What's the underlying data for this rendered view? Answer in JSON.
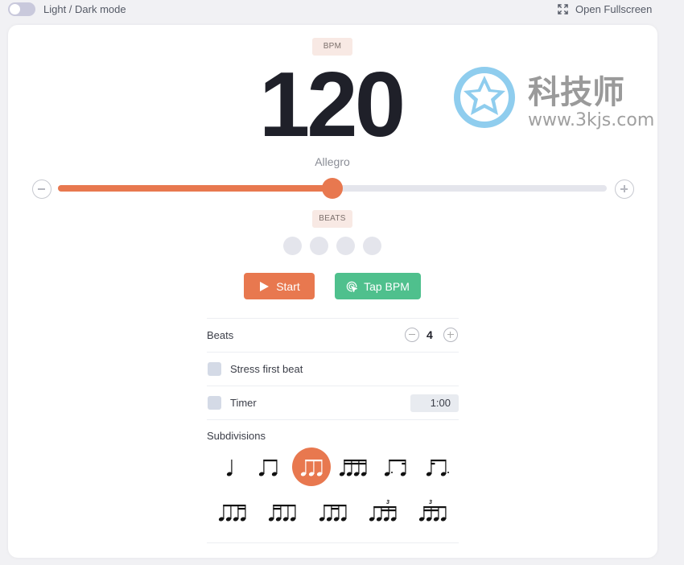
{
  "topbar": {
    "theme_toggle_label": "Light / Dark mode",
    "theme_toggle_on": false,
    "fullscreen_label": "Open Fullscreen"
  },
  "tempo": {
    "bpm_label": "BPM",
    "bpm": "120",
    "tempo_name": "Allegro",
    "slider_fraction": 0.5
  },
  "beats_display": {
    "label": "BEATS",
    "count": 4
  },
  "actions": {
    "start_label": "Start",
    "tap_label": "Tap BPM"
  },
  "settings": {
    "beats_label": "Beats",
    "beats_value": "4",
    "stress_label": "Stress first beat",
    "stress_checked": false,
    "timer_label": "Timer",
    "timer_checked": false,
    "timer_value": "1:00",
    "subdivisions_label": "Subdivisions"
  },
  "subdivisions": [
    {
      "name": "quarter",
      "active": false
    },
    {
      "name": "eighths",
      "active": false
    },
    {
      "name": "triplets",
      "active": true
    },
    {
      "name": "sixteenths",
      "active": false
    },
    {
      "name": "dotted-eighth-sixteenth",
      "active": false
    },
    {
      "name": "sixteenth-dotted-eighth",
      "active": false
    },
    {
      "name": "eighth-sixteenth-sixteenth-variant-1",
      "active": false
    },
    {
      "name": "sixteenth-variant-2",
      "active": false
    },
    {
      "name": "sixteenth-variant-3",
      "active": false
    },
    {
      "name": "sextuplet-1",
      "active": false,
      "tuplet": "3"
    },
    {
      "name": "sextuplet-2",
      "active": false,
      "tuplet": "3"
    }
  ],
  "colors": {
    "accent": "#e8784f",
    "tap": "#4fc08d",
    "bpm_text": "#1f2029"
  },
  "watermark": {
    "title": "科技师",
    "url": "www.3kjs.com"
  }
}
